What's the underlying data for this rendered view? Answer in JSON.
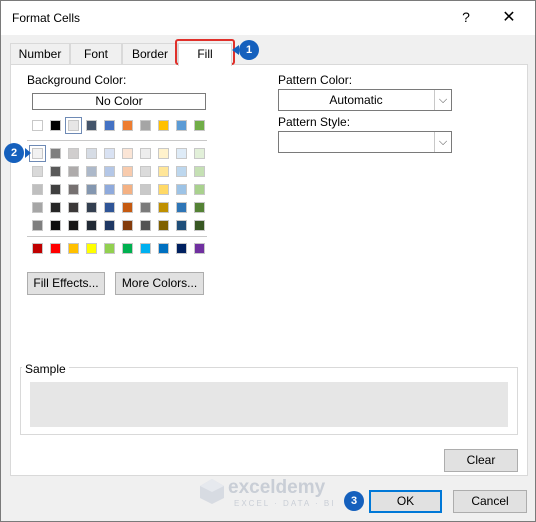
{
  "window": {
    "title": "Format Cells",
    "help": "?",
    "close": "✕"
  },
  "tabs": [
    {
      "label": "Number"
    },
    {
      "label": "Font"
    },
    {
      "label": "Border"
    },
    {
      "label": "Fill",
      "active": true
    }
  ],
  "fill": {
    "background_color_label": "Background Color:",
    "no_color_label": "No Color",
    "fill_effects_label": "Fill Effects...",
    "more_colors_label": "More Colors...",
    "pattern_color_label": "Pattern Color:",
    "pattern_color_value": "Automatic",
    "pattern_style_label": "Pattern Style:",
    "pattern_style_value": "",
    "sample_label": "Sample",
    "clear_label": "Clear"
  },
  "palette": {
    "theme_top": [
      "#ffffff",
      "#000000",
      "#e7e6e6",
      "#44546a",
      "#4472c4",
      "#ed7d31",
      "#a5a5a5",
      "#ffc000",
      "#5b9bd5",
      "#70ad47"
    ],
    "theme_shades": [
      [
        "#f2f2f2",
        "#7f7f7f",
        "#d0cece",
        "#d6dce5",
        "#d9e2f3",
        "#fbe5d6",
        "#ededed",
        "#fff2cc",
        "#deebf7",
        "#e2f0d9"
      ],
      [
        "#d9d9d9",
        "#595959",
        "#aeabab",
        "#adb9ca",
        "#b4c7e7",
        "#f8cbad",
        "#dbdbdb",
        "#ffe699",
        "#bdd7ee",
        "#c5e0b4"
      ],
      [
        "#bfbfbf",
        "#404040",
        "#767171",
        "#8497b0",
        "#8faadc",
        "#f4b183",
        "#c9c9c9",
        "#ffd966",
        "#9dc3e6",
        "#a9d18e"
      ],
      [
        "#a6a6a6",
        "#262626",
        "#3b3838",
        "#333f50",
        "#2f5597",
        "#c55a11",
        "#7b7b7b",
        "#bf9000",
        "#2e75b6",
        "#548235"
      ],
      [
        "#7f7f7f",
        "#0d0d0d",
        "#171616",
        "#222a35",
        "#1f3864",
        "#843c0c",
        "#525252",
        "#7f6000",
        "#1f4e79",
        "#385723"
      ]
    ],
    "standard": [
      "#c00000",
      "#ff0000",
      "#ffc000",
      "#ffff00",
      "#92d050",
      "#00b050",
      "#00b0f0",
      "#0070c0",
      "#002060",
      "#7030a0"
    ]
  },
  "buttons": {
    "ok": "OK",
    "cancel": "Cancel"
  },
  "callouts": [
    "1",
    "2",
    "3"
  ],
  "watermark": {
    "name": "exceldemy",
    "tagline": "EXCEL · DATA · BI"
  }
}
